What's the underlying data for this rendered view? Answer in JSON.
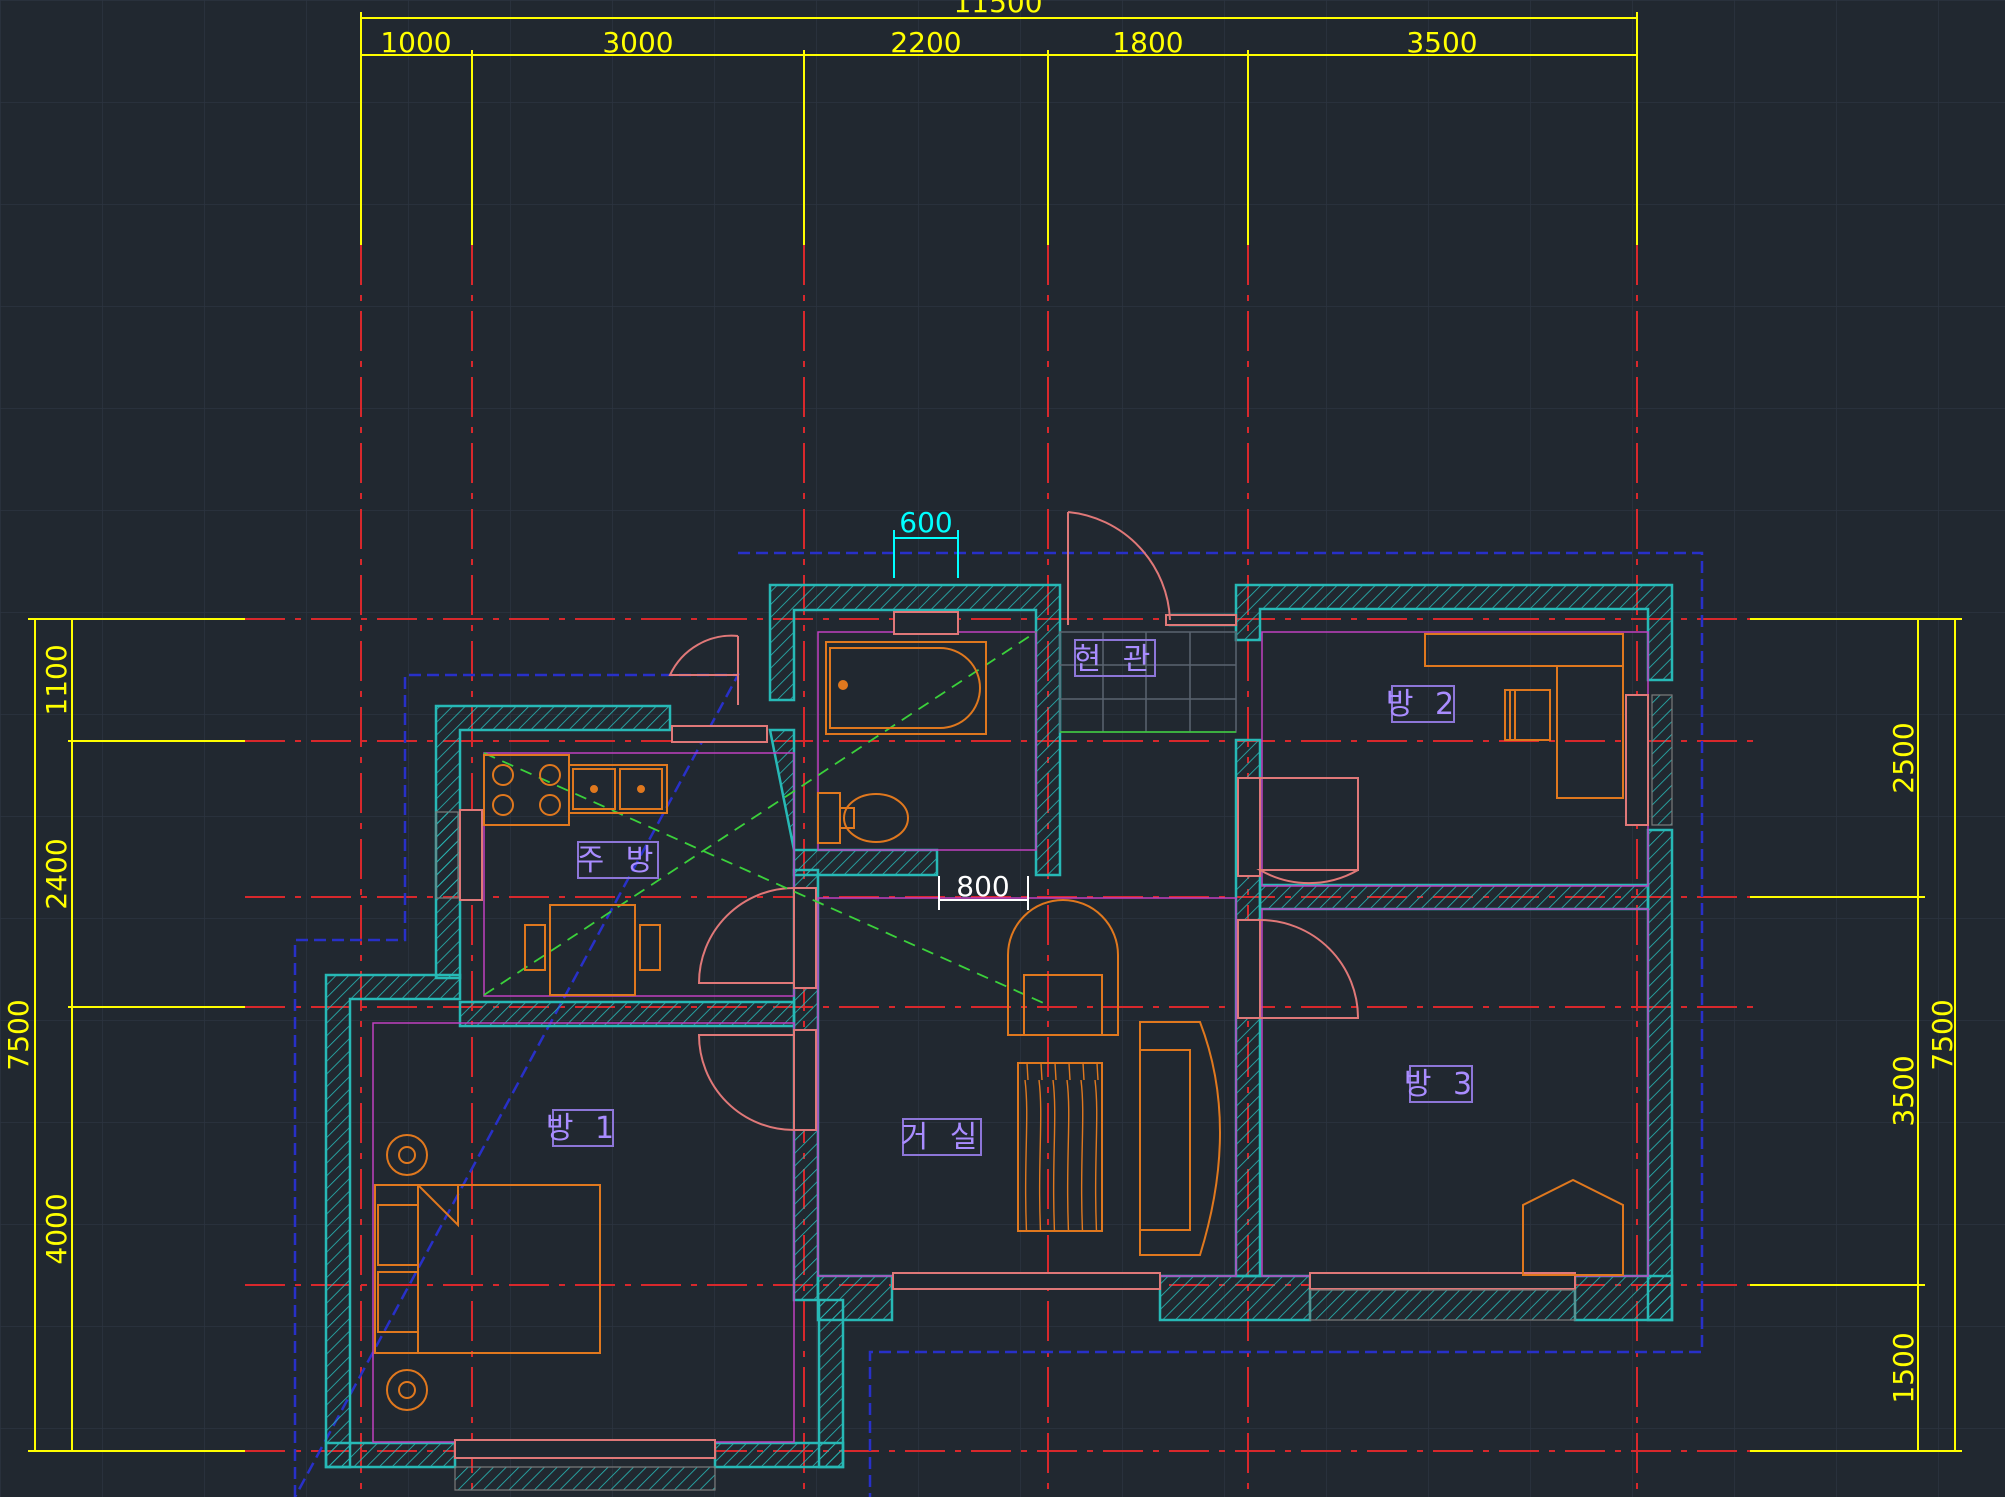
{
  "drawing": {
    "overall_width": "11500",
    "top_dims": [
      "1000",
      "3000",
      "2200",
      "1800",
      "3500"
    ],
    "window_dim": "600",
    "door_dim": "800",
    "left_overall": "7500",
    "left_dims": [
      "1100",
      "2400",
      "4000"
    ],
    "right_overall": "7500",
    "right_dims": [
      "2500",
      "3500",
      "1500"
    ]
  },
  "rooms": {
    "entrance": "현 관",
    "kitchen": "주 방",
    "room1": "방 1",
    "room2": "방 2",
    "room3": "방 3",
    "living": "거 실"
  },
  "colors": {
    "background": "#212830",
    "dimension": "#ffff00",
    "centerline": "#d8282c",
    "wall": "#27b9b6",
    "furniture": "#e0781e",
    "door": "#e07878",
    "label": "#a98cff",
    "outline": "#2830c8"
  }
}
